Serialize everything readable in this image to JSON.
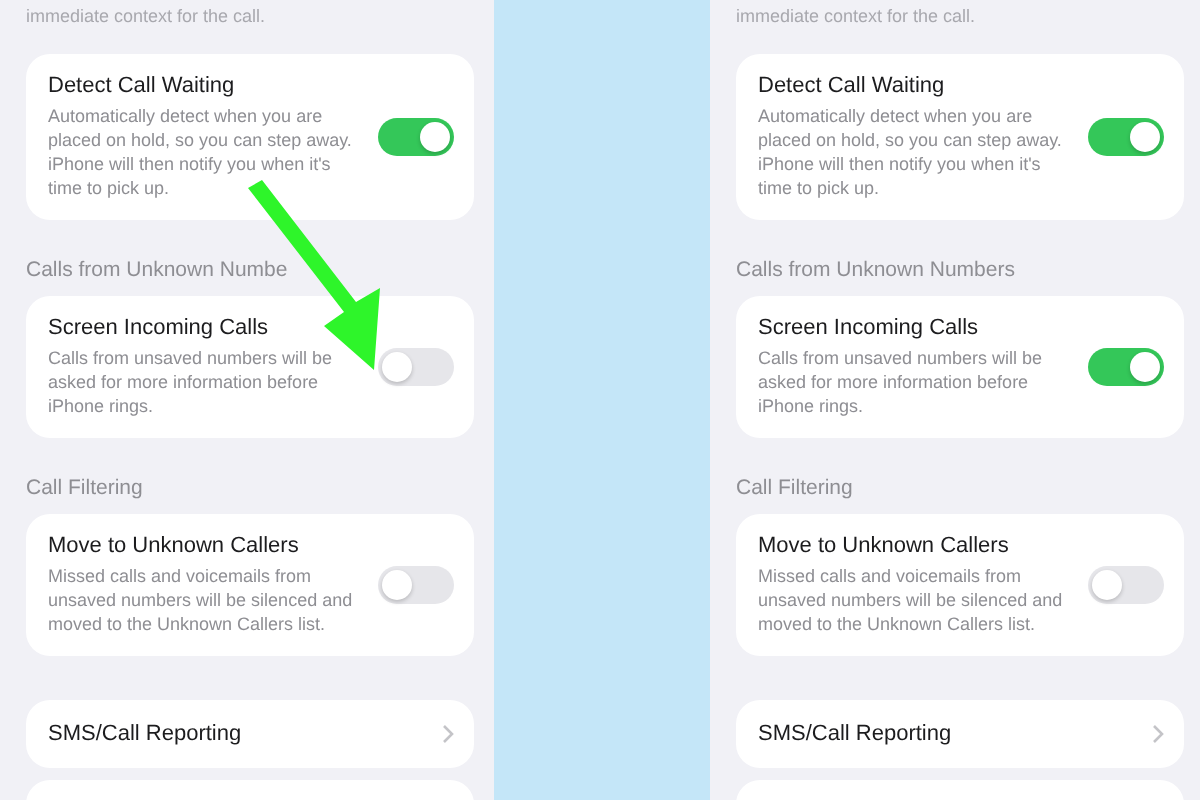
{
  "panels": [
    {
      "top_caption": "immediate context for the call.",
      "annotation_arrow": true,
      "groups": [
        {
          "rows": [
            {
              "kind": "toggle",
              "title": "Detect Call Waiting",
              "description": "Automatically detect when you are placed on hold, so you can step away. iPhone will then notify you when it's time to pick up.",
              "on": true
            }
          ]
        },
        {
          "header": "Calls from Unknown Numbe",
          "rows": [
            {
              "kind": "toggle",
              "title": "Screen Incoming Calls",
              "description": "Calls from unsaved numbers will be asked for more information before iPhone rings.",
              "on": false
            }
          ]
        },
        {
          "header": "Call Filtering",
          "rows": [
            {
              "kind": "toggle",
              "title": "Move to Unknown Callers",
              "description": "Missed calls and voicemails from unsaved numbers will be silenced and moved to the Unknown Callers list.",
              "on": false
            }
          ]
        },
        {
          "rows": [
            {
              "kind": "link",
              "title": "SMS/Call Reporting"
            }
          ]
        }
      ]
    },
    {
      "top_caption": "immediate context for the call.",
      "annotation_arrow": false,
      "groups": [
        {
          "rows": [
            {
              "kind": "toggle",
              "title": "Detect Call Waiting",
              "description": "Automatically detect when you are placed on hold, so you can step away. iPhone will then notify you when it's time to pick up.",
              "on": true
            }
          ]
        },
        {
          "header": "Calls from Unknown Numbers",
          "rows": [
            {
              "kind": "toggle",
              "title": "Screen Incoming Calls",
              "description": "Calls from unsaved numbers will be asked for more information before iPhone rings.",
              "on": true
            }
          ]
        },
        {
          "header": "Call Filtering",
          "rows": [
            {
              "kind": "toggle",
              "title": "Move to Unknown Callers",
              "description": "Missed calls and voicemails from unsaved numbers will be silenced and moved to the Unknown Callers list.",
              "on": false
            }
          ]
        },
        {
          "rows": [
            {
              "kind": "link",
              "title": "SMS/Call Reporting"
            }
          ]
        }
      ]
    }
  ]
}
